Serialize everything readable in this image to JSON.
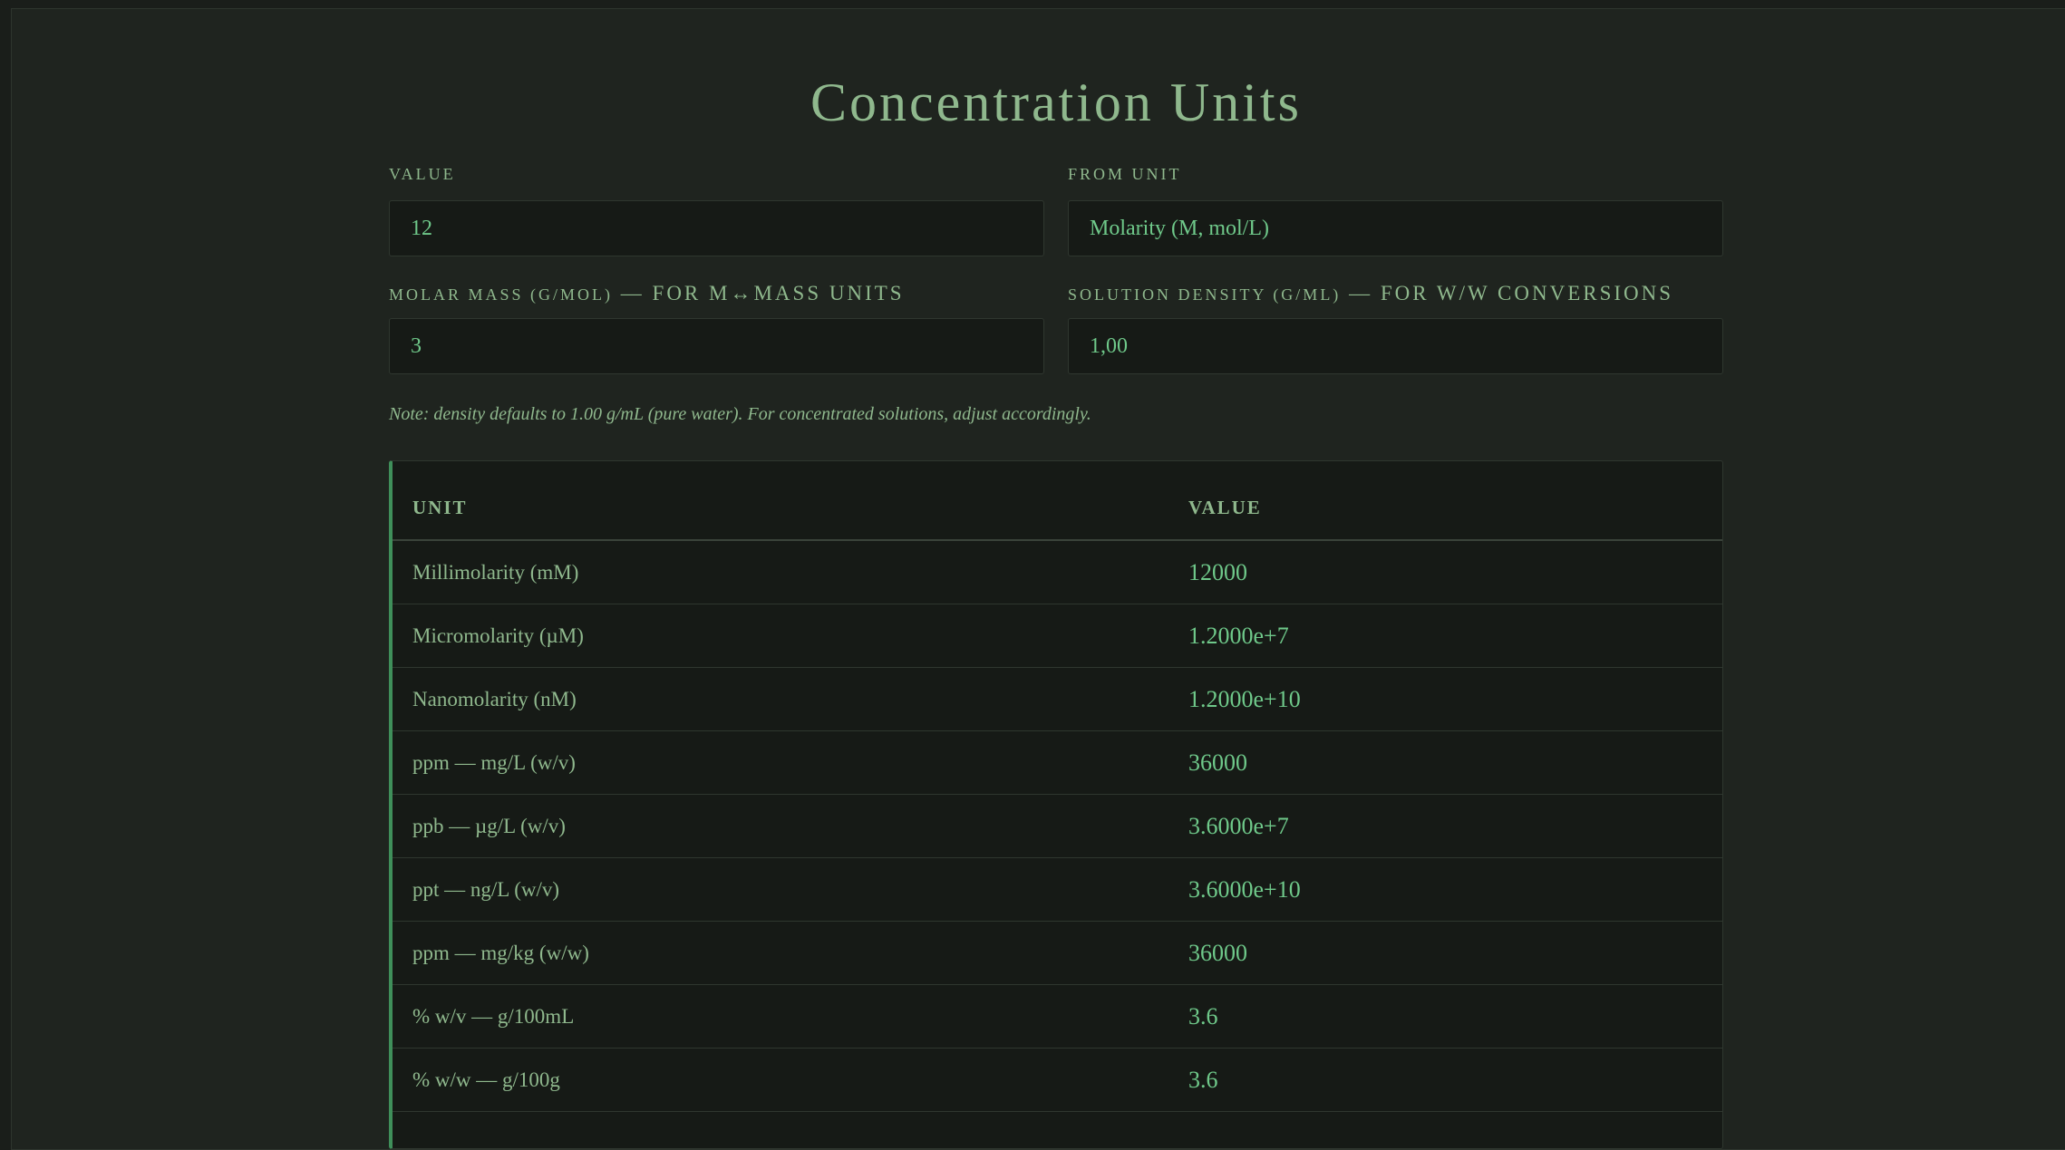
{
  "page": {
    "title": "Concentration Units",
    "note": "Note: density defaults to 1.00 g/mL (pure water). For concentrated solutions, adjust accordingly."
  },
  "inputs": {
    "value": {
      "label": "VALUE",
      "current": "12"
    },
    "from_unit": {
      "label": "FROM UNIT",
      "current": "Molarity (M, mol/L)"
    },
    "molar_mass": {
      "label": "MOLAR MASS (G/MOL)",
      "suffix": " — FOR M↔MASS UNITS",
      "current": "3"
    },
    "density": {
      "label": "SOLUTION DENSITY (G/ML)",
      "suffix": " — FOR W/W CONVERSIONS",
      "current": "1,00"
    }
  },
  "table": {
    "headers": {
      "unit": "UNIT",
      "value": "VALUE"
    },
    "rows": [
      {
        "unit": "Millimolarity (mM)",
        "value": "12000"
      },
      {
        "unit": "Micromolarity (µM)",
        "value": "1.2000e+7"
      },
      {
        "unit": "Nanomolarity (nM)",
        "value": "1.2000e+10"
      },
      {
        "unit": "ppm — mg/L (w/v)",
        "value": "36000"
      },
      {
        "unit": "ppb — µg/L (w/v)",
        "value": "3.6000e+7"
      },
      {
        "unit": "ppt — ng/L (w/v)",
        "value": "3.6000e+10"
      },
      {
        "unit": "ppm — mg/kg (w/w)",
        "value": "36000"
      },
      {
        "unit": "% w/v — g/100mL",
        "value": "3.6"
      },
      {
        "unit": "% w/w — g/100g",
        "value": "3.6"
      }
    ]
  },
  "colors": {
    "background": "#1f241f",
    "text": "#8fb88d",
    "accent": "#6fc98a",
    "border_accent": "#3f8f5a"
  }
}
